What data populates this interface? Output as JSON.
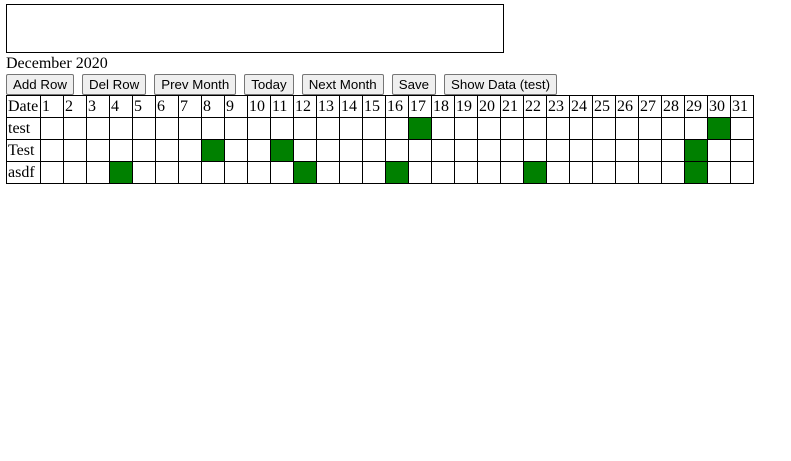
{
  "textarea": {
    "value": ""
  },
  "month_title": "December 2020",
  "toolbar": {
    "buttons": [
      {
        "id": "add-row",
        "label": "Add Row"
      },
      {
        "id": "del-row",
        "label": "Del Row"
      },
      {
        "id": "prev-month",
        "label": "Prev Month"
      },
      {
        "id": "today",
        "label": "Today"
      },
      {
        "id": "next-month",
        "label": "Next Month"
      },
      {
        "id": "save",
        "label": "Save"
      },
      {
        "id": "show-data",
        "label": "Show Data (test)"
      }
    ]
  },
  "grid": {
    "header_label": "Date",
    "days": [
      "1",
      "2",
      "3",
      "4",
      "5",
      "6",
      "7",
      "8",
      "9",
      "10",
      "11",
      "12",
      "13",
      "14",
      "15",
      "16",
      "17",
      "18",
      "19",
      "20",
      "21",
      "22",
      "23",
      "24",
      "25",
      "26",
      "27",
      "28",
      "29",
      "30",
      "31"
    ],
    "on_color": "#008000",
    "rows": [
      {
        "label": "test",
        "marked_days": [
          17,
          30
        ]
      },
      {
        "label": "Test",
        "marked_days": [
          8,
          11,
          29
        ]
      },
      {
        "label": "asdf",
        "marked_days": [
          4,
          12,
          16,
          22,
          29
        ]
      }
    ]
  }
}
